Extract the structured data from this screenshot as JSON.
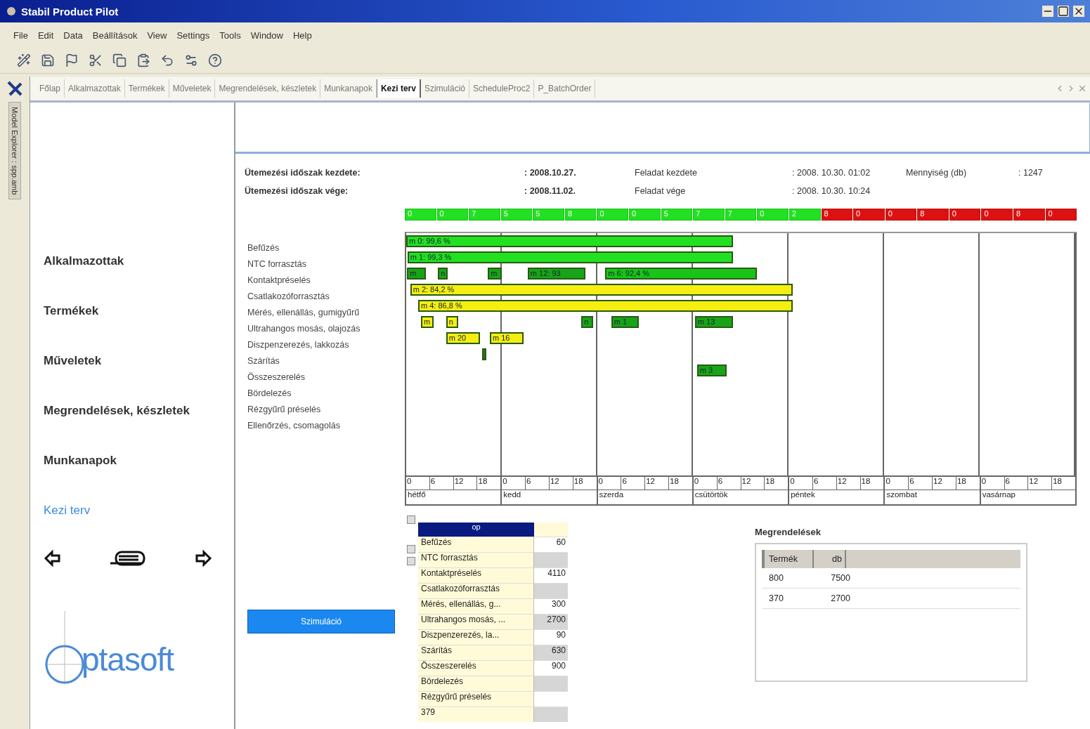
{
  "window": {
    "title": "Stabil Product Pilot"
  },
  "menu": [
    "File",
    "Edit",
    "Data",
    "Beállítások",
    "View",
    "Settings",
    "Tools",
    "Window",
    "Help"
  ],
  "side_tab": "Model Explorer : spp.amb",
  "tabs": [
    {
      "label": "Főlap",
      "selected": false
    },
    {
      "label": "Alkalmazottak",
      "selected": false
    },
    {
      "label": "Termékek",
      "selected": false
    },
    {
      "label": "Műveletek",
      "selected": false
    },
    {
      "label": "Megrendelések, készletek",
      "selected": false
    },
    {
      "label": "Munkanapok",
      "selected": false
    },
    {
      "label": "Kezi terv",
      "selected": true
    },
    {
      "label": "Szimuláció",
      "selected": false
    },
    {
      "label": "ScheduleProc2",
      "selected": false
    },
    {
      "label": "P_BatchOrder",
      "selected": false
    }
  ],
  "nav": {
    "items": [
      {
        "label": "Alkalmazottak",
        "selected": false
      },
      {
        "label": "Termékek",
        "selected": false
      },
      {
        "label": "Műveletek",
        "selected": false
      },
      {
        "label": "Megrendelések, készletek",
        "selected": false
      },
      {
        "label": "Munkanapok",
        "selected": false
      },
      {
        "label": "Kezi terv",
        "selected": true
      }
    ],
    "logo": "ptasoft"
  },
  "info": [
    [
      {
        "label": "Ütemezési időszak kezdete:",
        "value": ": 2008.10.27.",
        "kind": "period"
      },
      {
        "label": "Feladat kezdete",
        "value": ": 2008. 10.30. 01:02",
        "kind": "task"
      },
      {
        "label": "Mennyiség (db)",
        "value": ": 1247",
        "kind": "task"
      }
    ],
    [
      {
        "label": "Ütemezési időszak vége:",
        "value": ": 2008.11.02.",
        "kind": "period"
      },
      {
        "label": "Feladat vége",
        "value": ": 2008. 10.30. 10:24",
        "kind": "task"
      }
    ]
  ],
  "gantt": {
    "shifts": [
      {
        "text": "0",
        "color": "#22e022"
      },
      {
        "text": "0",
        "color": "#22e022"
      },
      {
        "text": "7",
        "color": "#22e022"
      },
      {
        "text": "5",
        "color": "#22e022"
      },
      {
        "text": "5",
        "color": "#22e022"
      },
      {
        "text": "8",
        "color": "#22e022"
      },
      {
        "text": "0",
        "color": "#22e022"
      },
      {
        "text": "0",
        "color": "#22e022"
      },
      {
        "text": "5",
        "color": "#22e022"
      },
      {
        "text": "7",
        "color": "#22e022"
      },
      {
        "text": "7",
        "color": "#22e022"
      },
      {
        "text": "0",
        "color": "#22e022"
      },
      {
        "text": "2",
        "color": "#22e022"
      },
      {
        "text": "8",
        "color": "#dd1111"
      },
      {
        "text": "0",
        "color": "#dd1111"
      },
      {
        "text": "0",
        "color": "#dd1111"
      },
      {
        "text": "8",
        "color": "#dd1111"
      },
      {
        "text": "0",
        "color": "#dd1111"
      },
      {
        "text": "0",
        "color": "#dd1111"
      },
      {
        "text": "8",
        "color": "#dd1111"
      },
      {
        "text": "0",
        "color": "#dd1111"
      }
    ],
    "rows": [
      {
        "name": "Befűzés",
        "bars": [
          {
            "label": "m 0: 99,6 %",
            "color": "#22e022"
          }
        ]
      },
      {
        "name": "NTC forrasztás",
        "bars": [
          {
            "label": "m 1: 99,3 %",
            "color": "#22e022"
          }
        ]
      },
      {
        "name": "Kontaktpréselés",
        "bars": [
          {
            "label": "m",
            "color": "#18a418"
          },
          {
            "label": "n",
            "color": "#18a418"
          },
          {
            "label": "m",
            "color": "#18a418"
          },
          {
            "label": "m 12: 93",
            "color": "#18a418"
          },
          {
            "label": "m 6: 92,4 %",
            "color": "#18c418"
          }
        ]
      },
      {
        "name": "Csatlakozóforrasztás",
        "bars": [
          {
            "label": "m 2: 84,2 %",
            "color": "#f5ee10"
          }
        ]
      },
      {
        "name": "Mérés, ellenállás, gumigyűrű",
        "bars": [
          {
            "label": "m 4: 86,8 %",
            "color": "#f5ee10"
          }
        ]
      },
      {
        "name": "Ultrahangos mosás, olajozás",
        "bars": [
          {
            "label": "m",
            "color": "#f5ee10"
          },
          {
            "label": "n",
            "color": "#f5ee10"
          },
          {
            "label": "n",
            "color": "#18a418"
          },
          {
            "label": "m 1",
            "color": "#18a418"
          },
          {
            "label": "m 13",
            "color": "#18a418"
          }
        ]
      },
      {
        "name": "Diszpenzerezés, lakkozás",
        "bars": [
          {
            "label": "m 20",
            "color": "#f5ee10"
          },
          {
            "label": "m 16",
            "color": "#f5ee10"
          }
        ]
      },
      {
        "name": "Szárítás",
        "bars": [
          {
            "color": "#2f6f2f"
          }
        ]
      },
      {
        "name": "Összeszerelés",
        "bars": [
          {
            "label": "m 3",
            "color": "#18a418"
          }
        ]
      },
      {
        "name": "Bördelezés",
        "bars": []
      },
      {
        "name": "Rézgyűrű préselés",
        "bars": []
      },
      {
        "name": "Ellenőrzés, csomagolás",
        "bars": []
      }
    ],
    "days": [
      {
        "name": "hétfő",
        "ticks": [
          "0",
          "6",
          "12",
          "18"
        ]
      },
      {
        "name": "kedd",
        "ticks": [
          "0",
          "6",
          "12",
          "18"
        ]
      },
      {
        "name": "szerda",
        "ticks": [
          "0",
          "6",
          "12",
          "18"
        ]
      },
      {
        "name": "csütörtök",
        "ticks": [
          "0",
          "6",
          "12",
          "18"
        ]
      },
      {
        "name": "péntek",
        "ticks": [
          "0",
          "6",
          "12",
          "18"
        ]
      },
      {
        "name": "szombat",
        "ticks": [
          "0",
          "6",
          "12",
          "18"
        ]
      },
      {
        "name": "vasárnap",
        "ticks": [
          "0",
          "6",
          "12",
          "18"
        ]
      }
    ]
  },
  "simulate_button": "Szimuláció",
  "op_table": {
    "header": "op",
    "rows": [
      {
        "name": "Befűzés",
        "value": "60",
        "shaded": false
      },
      {
        "name": "NTC forrasztás",
        "shaded": true
      },
      {
        "name": "Kontaktpréselés",
        "value": "4110",
        "shaded": false
      },
      {
        "name": "Csatlakozóforrasztás",
        "shaded": true
      },
      {
        "name": "Mérés, ellenállás, g...",
        "value": "300",
        "shaded": false
      },
      {
        "name": "Ultrahangos mosás, ...",
        "value": "2700",
        "shaded": true
      },
      {
        "name": "Diszpenzerezés, la...",
        "value": "90",
        "shaded": false
      },
      {
        "name": "Szárítás",
        "value": "630",
        "shaded": true
      },
      {
        "name": "Összeszerelés",
        "value": "900",
        "shaded": false
      },
      {
        "name": "Bördelezés",
        "shaded": true
      },
      {
        "name": "Rézgyűrű préselés",
        "shaded": false
      },
      {
        "name": "379",
        "shaded": true
      }
    ]
  },
  "orders": {
    "title": "Megrendelések",
    "columns": [
      "Termék",
      "db"
    ],
    "rows": [
      [
        "800",
        "7500"
      ],
      [
        "370",
        "2700"
      ]
    ]
  }
}
